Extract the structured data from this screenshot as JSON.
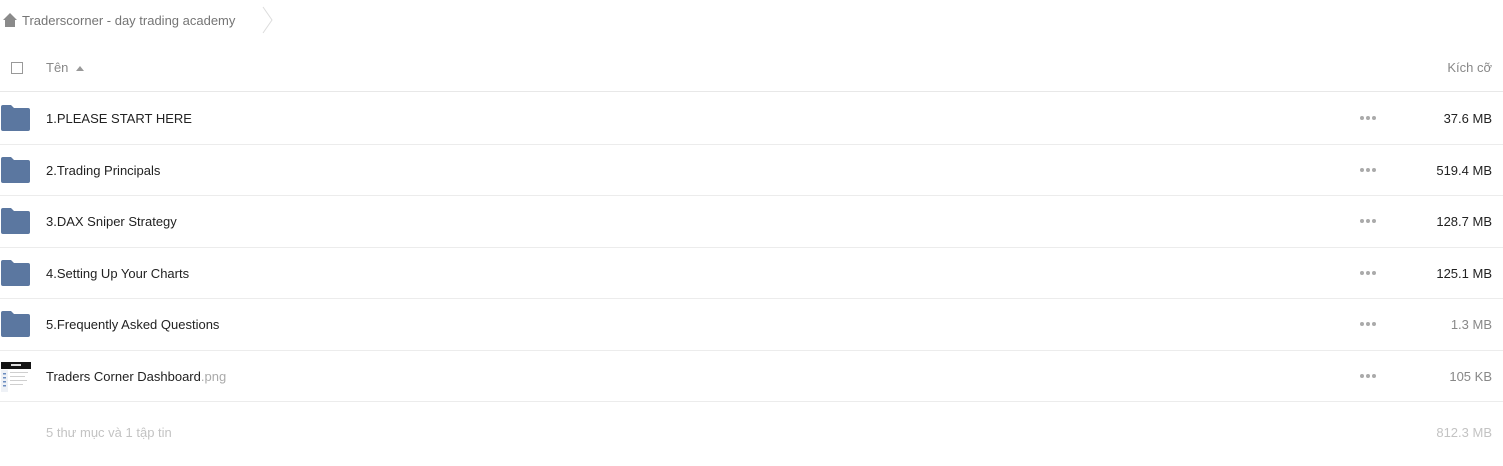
{
  "breadcrumb": {
    "icon": "home-icon",
    "label": "Traderscorner - day trading academy"
  },
  "header": {
    "name_col": "Tên",
    "size_col": "Kích cỡ"
  },
  "items": [
    {
      "type": "folder",
      "icon": "folder-icon",
      "name": "1.PLEASE START HERE",
      "ext": "",
      "size": "37.6 MB"
    },
    {
      "type": "folder",
      "icon": "folder-icon",
      "name": "2.Trading Principals",
      "ext": "",
      "size": "519.4 MB"
    },
    {
      "type": "folder",
      "icon": "folder-icon",
      "name": "3.DAX Sniper Strategy",
      "ext": "",
      "size": "128.7 MB"
    },
    {
      "type": "folder",
      "icon": "folder-icon",
      "name": "4.Setting Up Your Charts",
      "ext": "",
      "size": "125.1 MB"
    },
    {
      "type": "folder",
      "icon": "folder-icon",
      "name": "5.Frequently Asked Questions",
      "ext": "",
      "size": "1.3 MB"
    },
    {
      "type": "image",
      "icon": "image-thumbnail",
      "name": "Traders Corner Dashboard",
      "ext": ".png",
      "size": "105 KB"
    }
  ],
  "footer": {
    "summary": "5 thư mục và 1 tập tin",
    "total": "812.3 MB"
  },
  "colors": {
    "folder": "#5b77a0",
    "muted": "#888888",
    "footer_text": "#c3c3c3"
  }
}
